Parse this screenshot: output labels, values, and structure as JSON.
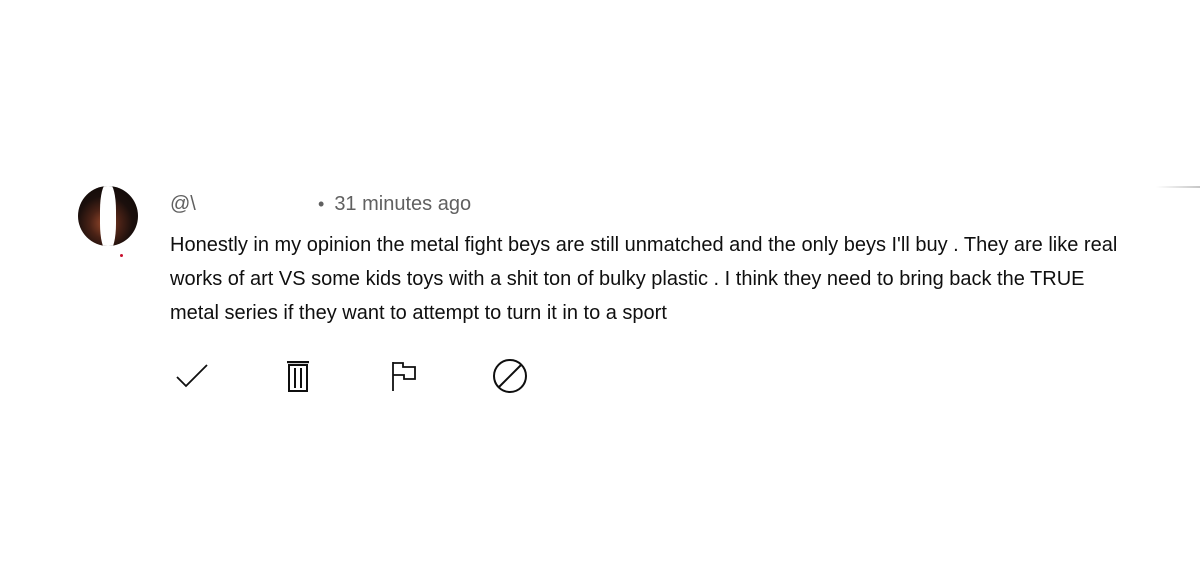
{
  "comment": {
    "author_handle": "@\\",
    "separator": "•",
    "timestamp": "31 minutes ago",
    "text": "Honestly in my opinion the metal fight beys are still unmatched and the only beys I'll buy . They are like real works of art VS some kids toys with a shit ton of bulky plastic . I think they need to bring back the TRUE metal series if they want to attempt to turn it in to a sport"
  },
  "actions": [
    {
      "icon": "check-icon"
    },
    {
      "icon": "trash-icon"
    },
    {
      "icon": "flag-icon"
    },
    {
      "icon": "block-icon"
    }
  ],
  "colors": {
    "text": "#0f0f0f",
    "meta": "#606060",
    "icon": "#0f0f0f"
  }
}
